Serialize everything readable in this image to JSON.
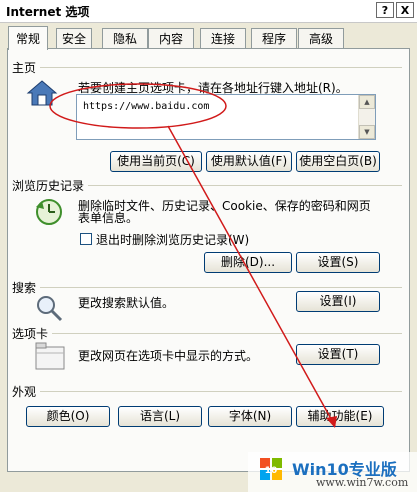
{
  "window": {
    "title": "Internet 选项",
    "help_button": "?",
    "close_button": "X"
  },
  "tabs": [
    "常规",
    "安全",
    "隐私",
    "内容",
    "连接",
    "程序",
    "高级"
  ],
  "homepage": {
    "section_title": "主页",
    "instruction": "若要创建主页选项卡，请在各地址行键入地址(R)。",
    "address": "https://www.baidu.com",
    "buttons": {
      "use_current": "使用当前页(C)",
      "use_default": "使用默认值(F)",
      "use_blank": "使用空白页(B)"
    }
  },
  "history": {
    "section_title": "浏览历史记录",
    "description_line1": "删除临时文件、历史记录、Cookie、保存的密码和网页",
    "description_line2": "表单信息。",
    "checkbox_label": "退出时删除浏览历史记录(W)",
    "checkbox_checked": false,
    "buttons": {
      "delete": "删除(D)...",
      "settings": "设置(S)"
    }
  },
  "search": {
    "section_title": "搜索",
    "description": "更改搜索默认值。",
    "settings_button": "设置(I)"
  },
  "tabs_section": {
    "section_title": "选项卡",
    "description": "更改网页在选项卡中显示的方式。",
    "settings_button": "设置(T)"
  },
  "appearance": {
    "section_title": "外观",
    "buttons": {
      "colors": "颜色(O)",
      "languages": "语言(L)",
      "fonts": "字体(N)",
      "accessibility": "辅助功能(E)"
    }
  },
  "watermark": {
    "logo_text": "10",
    "main_text": "Win10专业版",
    "url": "www.win7w.com"
  },
  "colors": {
    "annotation_red": "#d11a1a",
    "link_blue": "#1b6fbf"
  }
}
